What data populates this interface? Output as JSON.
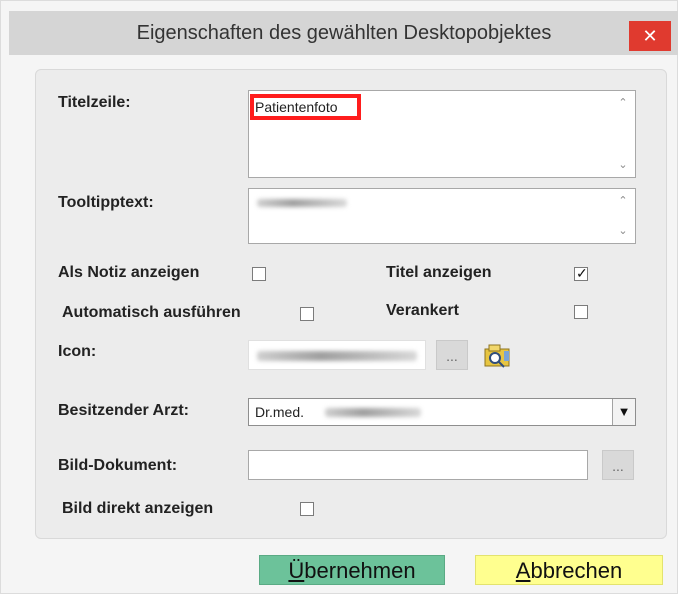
{
  "window": {
    "title": "Eigenschaften des gewählten Desktopobjektes",
    "close_symbol": "✕"
  },
  "form": {
    "titelzeile_label": "Titelzeile:",
    "titelzeile_value": "Patientenfoto",
    "tooltiptext_label": "Tooltipptext:",
    "als_notiz_label": "Als Notiz anzeigen",
    "als_notiz_checked": false,
    "titel_anzeigen_label": "Titel anzeigen",
    "titel_anzeigen_checked": true,
    "automatisch_label": "Automatisch ausführen",
    "automatisch_checked": false,
    "verankert_label": "Verankert",
    "verankert_checked": false,
    "icon_label": "Icon:",
    "icon_browse": "...",
    "besitzender_label": "Besitzender Arzt:",
    "besitzender_value": "Dr.med.",
    "bild_dokument_label": "Bild-Dokument:",
    "bild_dokument_browse": "...",
    "bild_direkt_label": "Bild direkt anzeigen",
    "bild_direkt_checked": false
  },
  "buttons": {
    "apply_first": "Ü",
    "apply_rest": "bernehmen",
    "cancel_first": "A",
    "cancel_rest": "bbrechen"
  },
  "colors": {
    "close_red": "#e03a2f",
    "apply_green": "#6cc29a",
    "cancel_yellow": "#ffff8f",
    "highlight_red": "#ff1d1d"
  },
  "icons": {
    "close": "close-icon",
    "folder": "folder-search-icon",
    "chevron_up": "chevron-up-icon",
    "chevron_down": "chevron-down-icon",
    "checkmark": "checkmark-icon",
    "dropdown": "dropdown-arrow-icon"
  }
}
